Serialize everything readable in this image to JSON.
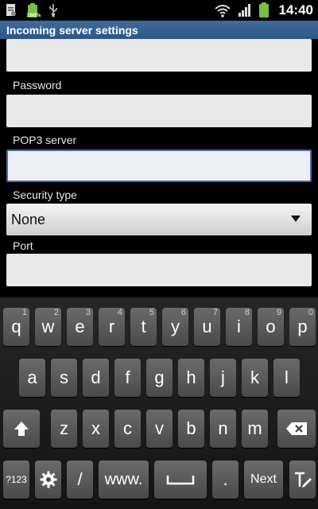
{
  "status_bar": {
    "time": "14:40",
    "icons": [
      "document-icon",
      "battery-full-icon",
      "usb-icon",
      "wifi-icon",
      "signal-icon",
      "battery-charging-icon"
    ],
    "battery_label": "100%"
  },
  "title": "Incoming server settings",
  "form": {
    "password_label": "Password",
    "pop3_label": "POP3 server",
    "security_label": "Security type",
    "security_value": "None",
    "port_label": "Port"
  },
  "keyboard": {
    "row1": [
      {
        "k": "q",
        "h": "1"
      },
      {
        "k": "w",
        "h": "2"
      },
      {
        "k": "e",
        "h": "3"
      },
      {
        "k": "r",
        "h": "4"
      },
      {
        "k": "t",
        "h": "5"
      },
      {
        "k": "y",
        "h": "6"
      },
      {
        "k": "u",
        "h": "7"
      },
      {
        "k": "i",
        "h": "8"
      },
      {
        "k": "o",
        "h": "9"
      },
      {
        "k": "p",
        "h": "0"
      }
    ],
    "row2": [
      "a",
      "s",
      "d",
      "f",
      "g",
      "h",
      "j",
      "k",
      "l"
    ],
    "row3": [
      "z",
      "x",
      "c",
      "v",
      "b",
      "n",
      "m"
    ],
    "symbols_key": "?123",
    "www_key": "www.",
    "slash_key": "/",
    "period_key": ".",
    "next_key": "Next"
  },
  "colors": {
    "titlebar": "#2d5686",
    "focus_border": "#3f70a8",
    "key_face": "#5a5a5a",
    "battery_green": "#76c043"
  }
}
